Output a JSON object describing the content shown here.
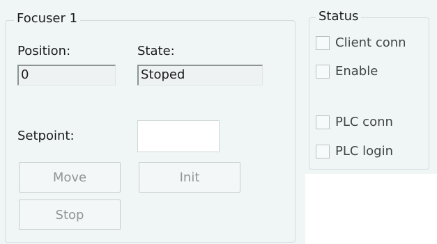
{
  "focuser": {
    "title": "Focuser 1",
    "position_label": "Position:",
    "position_value": "0",
    "state_label": "State:",
    "state_value": "Stoped",
    "setpoint_label": "Setpoint:",
    "setpoint_value": "",
    "buttons": {
      "move": "Move",
      "init": "Init",
      "stop": "Stop"
    }
  },
  "status": {
    "title": "Status",
    "checkboxes": [
      {
        "label": "Client conn",
        "checked": false
      },
      {
        "label": "Enable",
        "checked": false
      },
      {
        "label": "PLC conn",
        "checked": false
      },
      {
        "label": "PLC login",
        "checked": false
      }
    ]
  }
}
